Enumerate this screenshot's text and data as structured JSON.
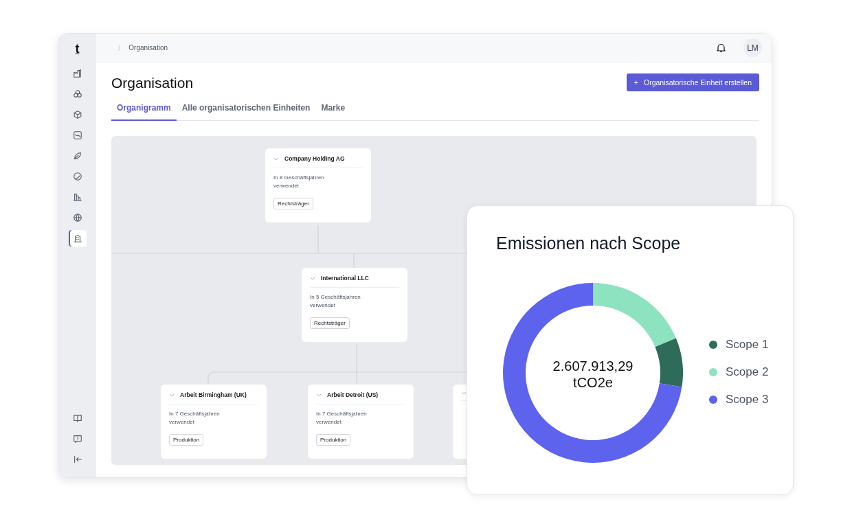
{
  "sidebar": {
    "logo": "t",
    "items": [
      {
        "kind": "factory",
        "selected": false
      },
      {
        "kind": "circles",
        "selected": false
      },
      {
        "kind": "cube",
        "selected": false
      },
      {
        "kind": "chart",
        "selected": false
      },
      {
        "kind": "leaf",
        "selected": false
      },
      {
        "kind": "swirl",
        "selected": false
      },
      {
        "kind": "bars",
        "selected": false
      },
      {
        "kind": "globe",
        "selected": false
      },
      {
        "kind": "building",
        "selected": true
      }
    ],
    "bottom_items": [
      {
        "kind": "book"
      },
      {
        "kind": "feedback"
      },
      {
        "kind": "collapse"
      }
    ]
  },
  "topbar": {
    "breadcrumb_separator": "/",
    "breadcrumb": "Organisation",
    "avatar": "LM"
  },
  "header": {
    "title": "Organisation",
    "button": {
      "icon": "+",
      "label": "Organisatorische Einheit erstellen"
    }
  },
  "tabs": [
    {
      "label": "Organigramm",
      "selected": true
    },
    {
      "label": "Alle organisatorischen Einheiten",
      "selected": false
    },
    {
      "label": "Marke",
      "selected": false
    }
  ],
  "org_chart": {
    "nodes": [
      {
        "name": "Company Holding AG",
        "usage": "In 8 Geschäftsjahren verwendet",
        "tag": "Rechtsträger"
      },
      {
        "name": "International LLC",
        "usage": "In 5 Geschäftsjahren verwendet",
        "tag": "Rechtsträger"
      },
      {
        "name": "Arbeit Birmingham (UK)",
        "usage": "In 7 Geschäftsjahren verwendet",
        "tag": "Produktion"
      },
      {
        "name": "Arbeit Detroit (US)",
        "usage": "In 7 Geschäftsjahren verwendet",
        "tag": "Produktion"
      },
      {
        "kind": "hidden"
      }
    ]
  },
  "emissions_card": {
    "title": "Emissionen nach Scope",
    "total": "2.607.913,29",
    "unit": "tCO2e",
    "legend": [
      {
        "label": "Scope 1",
        "color": "#2e6b59"
      },
      {
        "label": "Scope 2",
        "color": "#8de3c0"
      },
      {
        "label": "Scope 3",
        "color": "#5e63ee"
      }
    ]
  }
}
